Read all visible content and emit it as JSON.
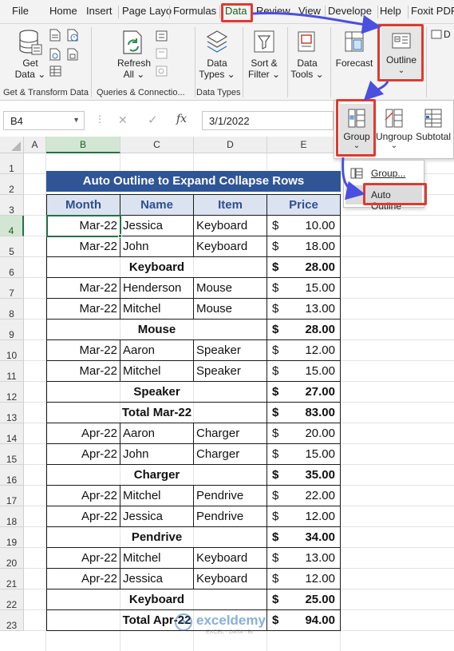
{
  "menu_tabs": [
    "File",
    "Home",
    "Insert",
    "Page Layo",
    "Formulas",
    "Data",
    "Review",
    "View",
    "Develope",
    "Help",
    "Foxit PDF"
  ],
  "active_tab": "Data",
  "ribbon": {
    "get_data": [
      "Get",
      "Data ⌄"
    ],
    "refresh_all": [
      "Refresh",
      "All ⌄"
    ],
    "data_types": [
      "Data",
      "Types ⌄"
    ],
    "sort_filter": [
      "Sort &",
      "Filter ⌄"
    ],
    "data_tools": [
      "Data",
      "Tools ⌄"
    ],
    "forecast": "Forecast",
    "outline": "Outline",
    "outline_chevron": "⌄",
    "group_labels": {
      "get_transform": "Get & Transform Data",
      "queries": "Queries & Connectio...",
      "data_types": "Data Types"
    },
    "cut_label": "D"
  },
  "outline_panel": {
    "group": "Group",
    "ungroup": "Ungroup",
    "subtotal": "Subtotal",
    "chevron": "⌄"
  },
  "group_menu": {
    "items": [
      "Group...",
      "Auto Outline"
    ]
  },
  "formula_bar": {
    "name_box": "B4",
    "value": "3/1/2022",
    "fx": "fx",
    "cancel": "✕",
    "enter": "✓"
  },
  "columns": [
    "A",
    "B",
    "C",
    "D",
    "E"
  ],
  "selected_column": "B",
  "selected_row": 4,
  "title": "Auto Outline to Expand Collapse Rows",
  "table_headers": [
    "Month",
    "Name",
    "Item",
    "Price"
  ],
  "currency": "$",
  "rows": [
    {
      "r": 4,
      "type": "data",
      "month": "Mar-22",
      "name": "Jessica",
      "item": "Keyboard",
      "price": "10.00"
    },
    {
      "r": 5,
      "type": "data",
      "month": "Mar-22",
      "name": "John",
      "item": "Keyboard",
      "price": "18.00"
    },
    {
      "r": 6,
      "type": "sub",
      "label": "Keyboard",
      "price": "28.00"
    },
    {
      "r": 7,
      "type": "data",
      "month": "Mar-22",
      "name": "Henderson",
      "item": "Mouse",
      "price": "15.00"
    },
    {
      "r": 8,
      "type": "data",
      "month": "Mar-22",
      "name": "Mitchel",
      "item": "Mouse",
      "price": "13.00"
    },
    {
      "r": 9,
      "type": "sub",
      "label": "Mouse",
      "price": "28.00"
    },
    {
      "r": 10,
      "type": "data",
      "month": "Mar-22",
      "name": "Aaron",
      "item": "Speaker",
      "price": "12.00"
    },
    {
      "r": 11,
      "type": "data",
      "month": "Mar-22",
      "name": "Mitchel",
      "item": "Speaker",
      "price": "15.00"
    },
    {
      "r": 12,
      "type": "sub",
      "label": "Speaker",
      "price": "27.00"
    },
    {
      "r": 13,
      "type": "total",
      "label": "Total Mar-22",
      "price": "83.00"
    },
    {
      "r": 14,
      "type": "data",
      "month": "Apr-22",
      "name": "Aaron",
      "item": "Charger",
      "price": "20.00"
    },
    {
      "r": 15,
      "type": "data",
      "month": "Apr-22",
      "name": "John",
      "item": "Charger",
      "price": "15.00"
    },
    {
      "r": 16,
      "type": "sub",
      "label": "Charger",
      "price": "35.00"
    },
    {
      "r": 17,
      "type": "data",
      "month": "Apr-22",
      "name": "Mitchel",
      "item": "Pendrive",
      "price": "22.00"
    },
    {
      "r": 18,
      "type": "data",
      "month": "Apr-22",
      "name": "Jessica",
      "item": "Pendrive",
      "price": "12.00"
    },
    {
      "r": 19,
      "type": "sub",
      "label": "Pendrive",
      "price": "34.00"
    },
    {
      "r": 20,
      "type": "data",
      "month": "Apr-22",
      "name": "Mitchel",
      "item": "Keyboard",
      "price": "13.00"
    },
    {
      "r": 21,
      "type": "data",
      "month": "Apr-22",
      "name": "Jessica",
      "item": "Keyboard",
      "price": "12.00"
    },
    {
      "r": 22,
      "type": "sub",
      "label": "Keyboard",
      "price": "25.00"
    },
    {
      "r": 23,
      "type": "total",
      "label": "Total Apr-22",
      "price": "94.00"
    }
  ],
  "watermark": {
    "brand": "exceldemy",
    "tagline": "EXCEL · DATA · BI"
  },
  "colors": {
    "title_bg": "#2f5597",
    "title_fg": "#ffffff",
    "header_fg": "#2f4f8f",
    "highlight": "#e03a2f",
    "arrow": "#4a4fe0",
    "selection": "#217346"
  }
}
